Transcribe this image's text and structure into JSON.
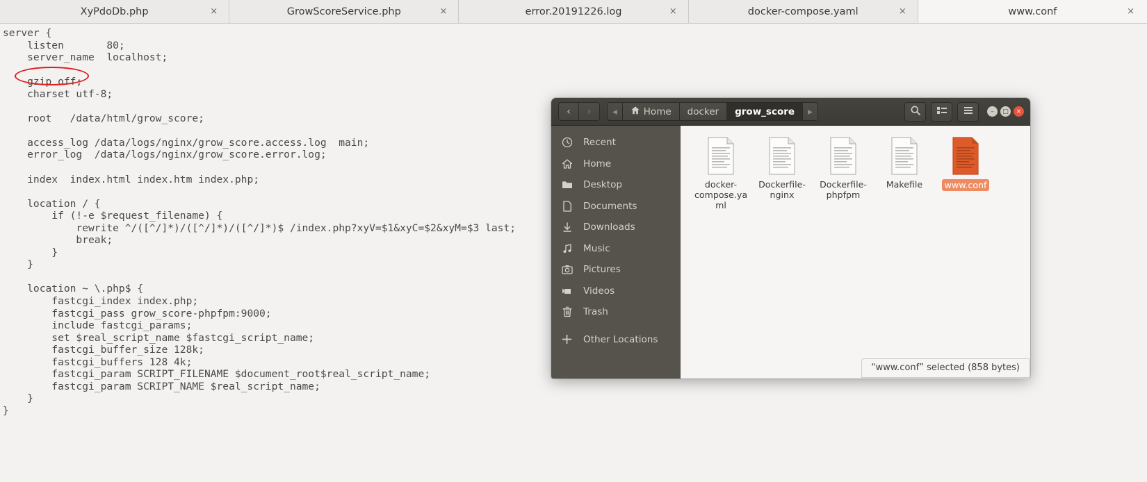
{
  "editor": {
    "tabs": [
      {
        "label": "XyPdoDb.php",
        "close": "×",
        "active": false
      },
      {
        "label": "GrowScoreService.php",
        "close": "×",
        "active": false
      },
      {
        "label": "error.20191226.log",
        "close": "×",
        "active": false
      },
      {
        "label": "docker-compose.yaml",
        "close": "×",
        "active": false
      },
      {
        "label": "www.conf",
        "close": "×",
        "active": true
      }
    ],
    "code": "server {\n    listen       80;\n    server_name  localhost;\n\n    gzip off;\n    charset utf-8;\n\n    root   /data/html/grow_score;\n\n    access_log /data/logs/nginx/grow_score.access.log  main;\n    error_log  /data/logs/nginx/grow_score.error.log;\n\n    index  index.html index.htm index.php;\n\n    location / {\n        if (!-e $request_filename) {\n            rewrite ^/([^/]*)/([^/]*)/([^/]*)$ /index.php?xyV=$1&xyC=$2&xyM=$3 last;\n            break;\n        }\n    }\n\n    location ~ \\.php$ {\n        fastcgi_index index.php;\n        fastcgi_pass grow_score-phpfpm:9000;\n        include fastcgi_params;\n        set $real_script_name $fastcgi_script_name;\n        fastcgi_buffer_size 128k;\n        fastcgi_buffers 128 4k;\n        fastcgi_param SCRIPT_FILENAME $document_root$real_script_name;\n        fastcgi_param SCRIPT_NAME $real_script_name;\n    }\n}",
    "annotation_color": "#e01b1b",
    "annotated_text": "gzip off;"
  },
  "filemanager": {
    "nav": {
      "back": "‹",
      "forward": "›",
      "crumb_prev": "◂",
      "crumb_next": "▸"
    },
    "breadcrumbs": [
      {
        "label": "Home",
        "icon": "home-icon",
        "current": false
      },
      {
        "label": "docker",
        "icon": "",
        "current": false
      },
      {
        "label": "grow_score",
        "icon": "",
        "current": true
      }
    ],
    "toolbar": {
      "search": "search-icon",
      "view_list": "view-list-icon",
      "menu": "hamburger-menu-icon"
    },
    "window_controls": {
      "minimize": "–",
      "maximize": "□",
      "close": "×"
    },
    "sidebar": [
      {
        "label": "Recent",
        "icon": "clock-icon"
      },
      {
        "label": "Home",
        "icon": "home-icon"
      },
      {
        "label": "Desktop",
        "icon": "folder-icon"
      },
      {
        "label": "Documents",
        "icon": "document-icon"
      },
      {
        "label": "Downloads",
        "icon": "download-icon"
      },
      {
        "label": "Music",
        "icon": "music-note-icon"
      },
      {
        "label": "Pictures",
        "icon": "camera-icon"
      },
      {
        "label": "Videos",
        "icon": "video-camera-icon"
      },
      {
        "label": "Trash",
        "icon": "trash-icon"
      },
      {
        "label": "Other Locations",
        "icon": "plus-icon"
      }
    ],
    "files": [
      {
        "name": "docker-compose.yaml",
        "selected": false
      },
      {
        "name": "Dockerfile-nginx",
        "selected": false
      },
      {
        "name": "Dockerfile-phpfpm",
        "selected": false
      },
      {
        "name": "Makefile",
        "selected": false
      },
      {
        "name": "www.conf",
        "selected": true
      }
    ],
    "status": "“www.conf” selected  (858 bytes)",
    "selection_color": "#ef8b63"
  }
}
